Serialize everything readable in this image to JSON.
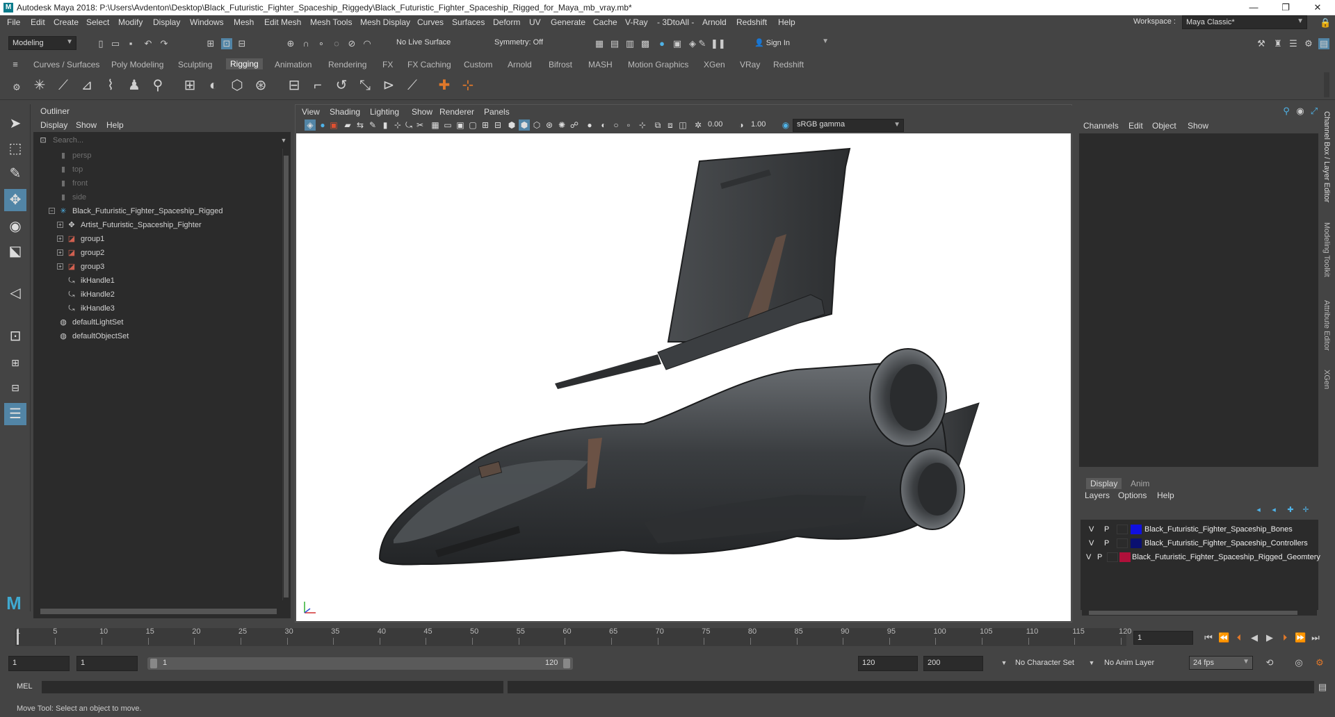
{
  "window": {
    "title": "Autodesk Maya 2018: P:\\Users\\Avdenton\\Desktop\\Black_Futuristic_Fighter_Spaceship_Riggedy\\Black_Futuristic_Fighter_Spaceship_Rigged_for_Maya_mb_vray.mb*",
    "app_icon": "M",
    "minimize": "—",
    "maximize": "❐",
    "close": "✕"
  },
  "menubar": {
    "items": [
      "File",
      "Edit",
      "Create",
      "Select",
      "Modify",
      "Display",
      "Windows",
      "Mesh",
      "Edit Mesh",
      "Mesh Tools",
      "Mesh Display",
      "Curves",
      "Surfaces",
      "Deform",
      "UV",
      "Generate",
      "Cache",
      "V-Ray",
      "- 3DtoAll -",
      "Arnold",
      "Redshift",
      "Help"
    ],
    "workspace_label": "Workspace :",
    "workspace_value": "Maya Classic*"
  },
  "statusline": {
    "mode": "Modeling",
    "live_surface": "No Live Surface",
    "symmetry": "Symmetry: Off",
    "sign_in": "Sign In"
  },
  "shelf": {
    "tabs": [
      "Curves / Surfaces",
      "Poly Modeling",
      "Sculpting",
      "Rigging",
      "Animation",
      "Rendering",
      "FX",
      "FX Caching",
      "Custom",
      "Arnold",
      "Bifrost",
      "MASH",
      "Motion Graphics",
      "XGen",
      "VRay",
      "Redshift"
    ],
    "active_tab": "Rigging"
  },
  "outliner": {
    "title": "Outliner",
    "menu": [
      "Display",
      "Show",
      "Help"
    ],
    "search_placeholder": "Search...",
    "items": [
      {
        "label": "persp",
        "icon": "camera-icon",
        "dim": true,
        "expandable": false,
        "indent": 0
      },
      {
        "label": "top",
        "icon": "camera-icon",
        "dim": true,
        "expandable": false,
        "indent": 0
      },
      {
        "label": "front",
        "icon": "camera-icon",
        "dim": true,
        "expandable": false,
        "indent": 0
      },
      {
        "label": "side",
        "icon": "camera-icon",
        "dim": true,
        "expandable": false,
        "indent": 0
      },
      {
        "label": "Black_Futuristic_Fighter_Spaceship_Rigged",
        "icon": "joint-icon",
        "dim": false,
        "expandable": true,
        "expanded": true,
        "indent": 0
      },
      {
        "label": "Artist_Futuristic_Spaceship_Fighter",
        "icon": "locator-icon",
        "dim": false,
        "expandable": true,
        "indent": 1
      },
      {
        "label": "group1",
        "icon": "transform-icon",
        "dim": false,
        "expandable": true,
        "indent": 1
      },
      {
        "label": "group2",
        "icon": "transform-icon",
        "dim": false,
        "expandable": true,
        "indent": 1
      },
      {
        "label": "group3",
        "icon": "transform-icon",
        "dim": false,
        "expandable": true,
        "indent": 1
      },
      {
        "label": "ikHandle1",
        "icon": "ik-handle-icon",
        "dim": false,
        "expandable": false,
        "indent": 1
      },
      {
        "label": "ikHandle2",
        "icon": "ik-handle-icon",
        "dim": false,
        "expandable": false,
        "indent": 1
      },
      {
        "label": "ikHandle3",
        "icon": "ik-handle-icon",
        "dim": false,
        "expandable": false,
        "indent": 1
      },
      {
        "label": "defaultLightSet",
        "icon": "set-icon",
        "dim": false,
        "expandable": false,
        "indent": 0
      },
      {
        "label": "defaultObjectSet",
        "icon": "set-icon",
        "dim": false,
        "expandable": false,
        "indent": 0
      }
    ]
  },
  "viewport": {
    "menu": [
      "View",
      "Shading",
      "Lighting",
      "Show",
      "Renderer",
      "Panels"
    ],
    "exposure": "0.00",
    "gamma": "1.00",
    "colorspace": "sRGB gamma"
  },
  "channelbox": {
    "menu": [
      "Channels",
      "Edit",
      "Object",
      "Show"
    ]
  },
  "layers": {
    "tabs": [
      "Display",
      "Anim"
    ],
    "active_tab": "Display",
    "menu": [
      "Layers",
      "Options",
      "Help"
    ],
    "rows": [
      {
        "v": "V",
        "p": "P",
        "color": "#1010e0",
        "name": "Black_Futuristic_Fighter_Spaceship_Bones"
      },
      {
        "v": "V",
        "p": "P",
        "color": "#0a1070",
        "name": "Black_Futuristic_Fighter_Spaceship_Controllers"
      },
      {
        "v": "V",
        "p": "P",
        "color": "#b0103a",
        "name": "Black_Futuristic_Fighter_Spaceship_Rigged_Geomtery"
      }
    ]
  },
  "sidetabs": [
    "Channel Box / Layer Editor",
    "Modeling Toolkit",
    "Attribute Editor",
    "XGen"
  ],
  "timeline": {
    "ticks": [
      "1",
      "5",
      "10",
      "15",
      "20",
      "25",
      "30",
      "35",
      "40",
      "45",
      "50",
      "55",
      "60",
      "65",
      "70",
      "75",
      "80",
      "85",
      "90",
      "95",
      "100",
      "105",
      "110",
      "115",
      "120"
    ],
    "current_frame": "1"
  },
  "range": {
    "start": "1",
    "playback_start": "1",
    "slider_start": "1",
    "slider_end": "120",
    "playback_end": "120",
    "end": "200",
    "character_set": "No Character Set",
    "anim_layer": "No Anim Layer",
    "fps": "24 fps"
  },
  "cmdline": {
    "label": "MEL"
  },
  "helpline": {
    "text": "Move Tool: Select an object to move."
  }
}
